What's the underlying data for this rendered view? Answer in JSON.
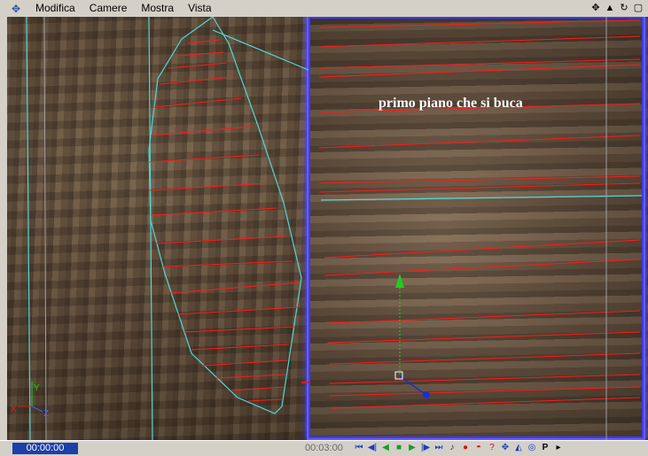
{
  "menubar": {
    "app_icon": "axis-tool-icon",
    "items": [
      "Modifica",
      "Camere",
      "Mostra",
      "Vista"
    ],
    "nav_icons": [
      "move-view-icon",
      "zoom-view-icon",
      "rotate-view-icon",
      "maximize-view-icon"
    ]
  },
  "viewport": {
    "annotation": "primo piano che si buca"
  },
  "timeline": {
    "start_time": "00:00:00",
    "end_time": "00:03:00",
    "controls": [
      "goto-start-icon",
      "prev-key-icon",
      "play-reverse-icon",
      "stop-icon",
      "play-icon",
      "next-key-icon",
      "goto-end-icon",
      "sound-icon",
      "record-icon",
      "autokey-icon",
      "help-icon",
      "move-tool-icon",
      "scale-tool-icon",
      "rotate-tool-icon",
      "point-mode-icon",
      "expand-icon"
    ]
  },
  "colors": {
    "wire_cyan": "#4fd8d8",
    "line_red": "#ff1a1a",
    "inset_border": "#3c3cff",
    "axis_green": "#22cc22",
    "axis_blue": "#1b2fd0",
    "timeline_blue": "#1d3fa8"
  }
}
